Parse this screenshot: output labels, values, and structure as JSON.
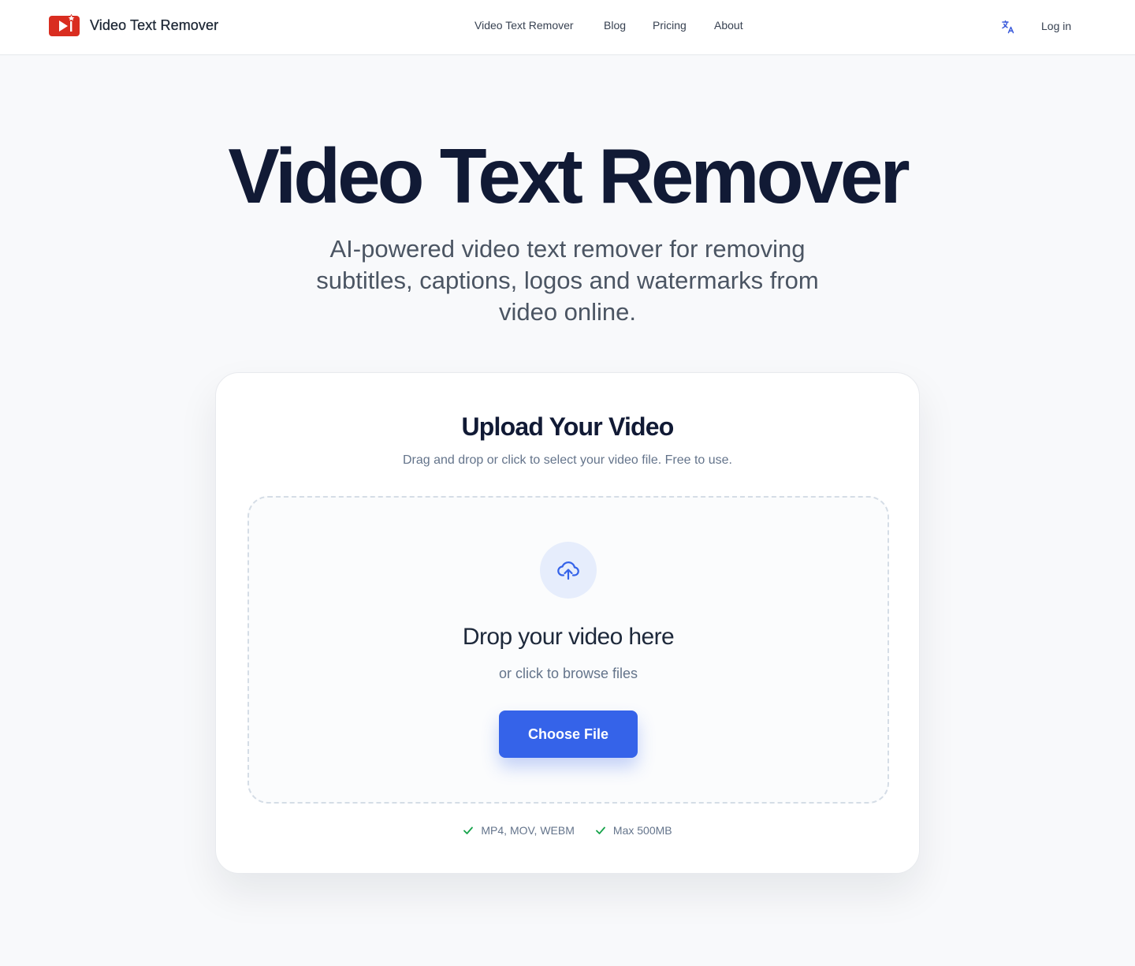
{
  "header": {
    "brand": {
      "name": "Video Text Remover",
      "icon": "play-video-logo-icon"
    },
    "nav": [
      {
        "label": "Video Text Remover"
      },
      {
        "label": "Blog"
      },
      {
        "label": "Pricing"
      },
      {
        "label": "About"
      }
    ],
    "language_icon": "translate-icon",
    "login_label": "Log in"
  },
  "hero": {
    "title": "Video Text Remover",
    "subtitle": "AI-powered video text remover for removing subtitles, captions, logos and watermarks from video online."
  },
  "upload_card": {
    "title": "Upload Your Video",
    "description": "Drag and drop or click to select your video file. Free to use.",
    "dropzone": {
      "icon": "cloud-upload-icon",
      "title": "Drop your video here",
      "subtitle": "or click to browse files",
      "button_label": "Choose File"
    },
    "features": [
      {
        "label": "MP4, MOV, WEBM",
        "icon": "check-icon"
      },
      {
        "label": "Max 500MB",
        "icon": "check-icon"
      }
    ]
  },
  "colors": {
    "accent": "#3563e9",
    "brand_red": "#d92d20",
    "title": "#111a35",
    "check_green": "#16a34a",
    "background": "#f8f9fb"
  }
}
